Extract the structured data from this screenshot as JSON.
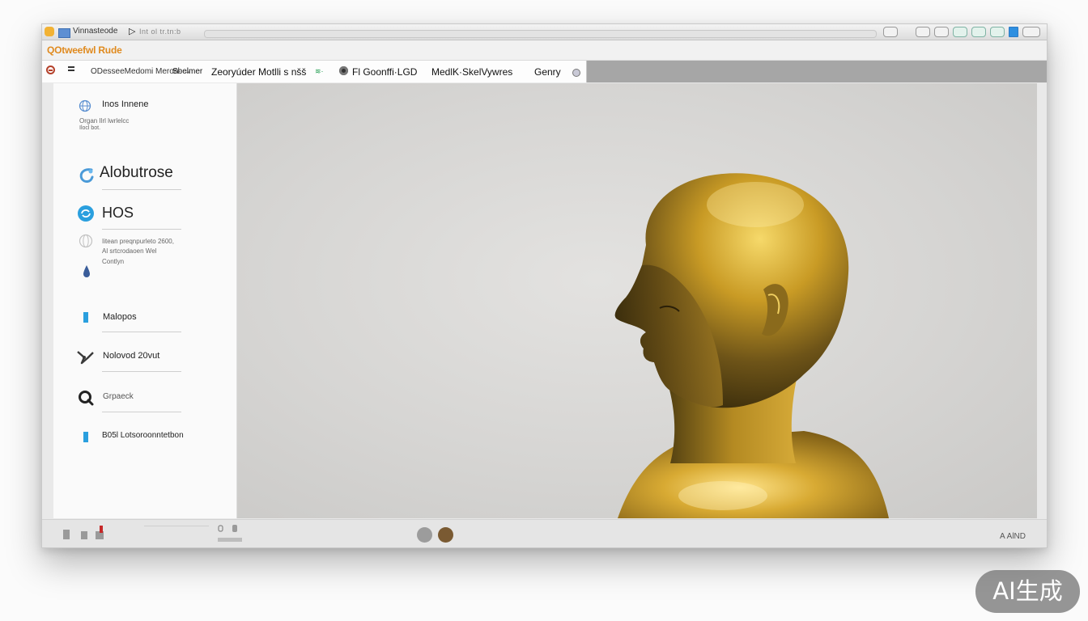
{
  "titlebar": {
    "tab_title": "Vinnasteode",
    "tab_secondary": "Int  ol  tr.tn:b",
    "play_glyph": "▷"
  },
  "app": {
    "title": "QOtweefwl Rude"
  },
  "nav": {
    "breadcrumb": "ODesseeMedomi Meron· →",
    "items": [
      {
        "label": "Sbelmer"
      },
      {
        "label": "Zeoryúder Motlli  s nšš"
      },
      {
        "label": "Fl Goonffi·LGD"
      },
      {
        "label": "MedlK·SkelVywres"
      },
      {
        "label": "Genry"
      }
    ],
    "indicator": "≋·"
  },
  "sidebar": {
    "items": [
      {
        "icon": "globe-icon",
        "label": "Inos Innene",
        "sublabel": [
          "Organ  Ilrl  lwrlelcc",
          "         Ilocl bot."
        ]
      },
      {
        "icon": "swirl-icon",
        "label": "Alobutrose"
      },
      {
        "icon": "sync-icon",
        "label": "HOS"
      },
      {
        "icon": "globe-outline-icon",
        "label": "",
        "sublabel": [
          "Iitean preqnpurleto 2600,",
          "Al srtcrodaoen Wel",
          "Contlyn"
        ]
      },
      {
        "icon": "drop-icon",
        "label": ""
      },
      {
        "icon": "rect-icon",
        "label": "Malopos"
      },
      {
        "icon": "pen-tool-icon",
        "label": "Nolovod 20vut"
      },
      {
        "icon": "search-icon",
        "label": "Grpaeck"
      },
      {
        "icon": "rect-icon",
        "label": "B05l Lotsoroonntetbon"
      }
    ]
  },
  "statusbar": {
    "mini_label": "IE  B  B",
    "swatches": [
      "#9c9c9c",
      "#7a5a32"
    ],
    "zoom": "A AlND"
  },
  "colors": {
    "app_title": "#e08a1e",
    "accent_blue": "#2a9fde",
    "sculpture_gold": "#c9a12a"
  },
  "watermark": {
    "text": "AI生成"
  }
}
